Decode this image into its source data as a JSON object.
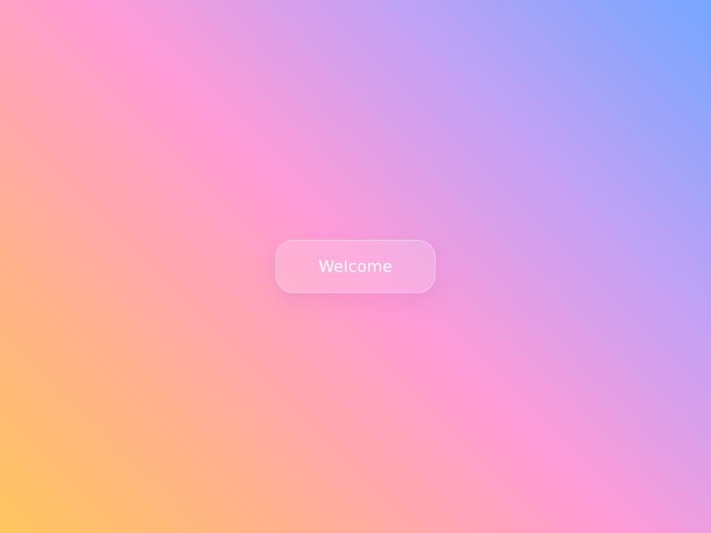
{
  "background": {
    "gradient_colors": [
      "#FFC65F",
      "#FFB28A",
      "#FF9BD6",
      "#C7A1F4",
      "#75A7FF"
    ]
  },
  "main": {
    "welcome_button": {
      "label": "Welcome"
    }
  },
  "colors": {
    "button_text": "#FFFFFF",
    "button_fill": "rgba(255,255,255,0.18)",
    "button_border": "rgba(255,255,255,0.35)"
  }
}
